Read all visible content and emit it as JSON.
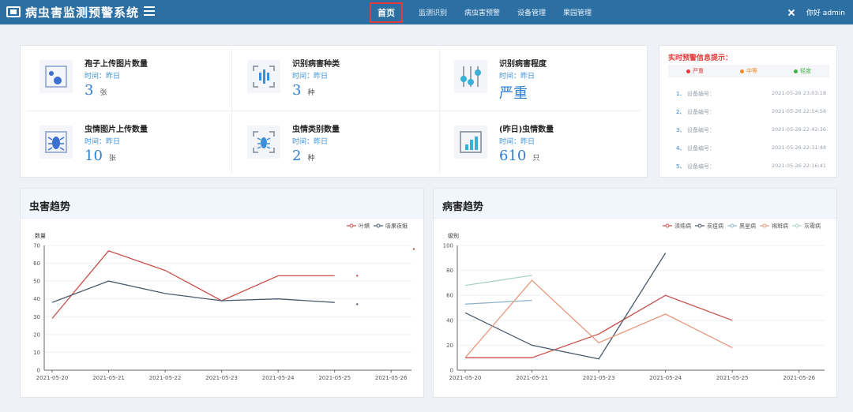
{
  "header": {
    "title": "病虫害监测预警系统",
    "nav": [
      "首页",
      "监测识别",
      "病虫害预警",
      "设备管理",
      "果园管理"
    ],
    "active_index": 0,
    "greeting": "你好 admin"
  },
  "stats": [
    {
      "label": "孢子上传图片数量",
      "time": "时间：昨日",
      "value": "3",
      "unit": "张",
      "icon": "spore-image-icon"
    },
    {
      "label": "识别病害种类",
      "time": "时间：昨日",
      "value": "3",
      "unit": "种",
      "icon": "disease-scan-icon"
    },
    {
      "label": "识别病害程度",
      "time": "时间：昨日",
      "value": "严重",
      "unit": "",
      "icon": "slider-level-icon"
    },
    {
      "label": "虫情图片上传数量",
      "time": "时间：昨日",
      "value": "10",
      "unit": "张",
      "icon": "insect-image-icon"
    },
    {
      "label": "虫情类别数量",
      "time": "时间：昨日",
      "value": "2",
      "unit": "种",
      "icon": "insect-scan-icon"
    },
    {
      "label": "(昨日)虫情数量",
      "time": "时间：昨日",
      "value": "610",
      "unit": "只",
      "icon": "bar-chart-icon"
    }
  ],
  "warning": {
    "title": "实时预警信息提示：",
    "levels": [
      {
        "label": "严重",
        "color": "#e53a3a"
      },
      {
        "label": "中等",
        "color": "#f08a24"
      },
      {
        "label": "轻度",
        "color": "#3cb043"
      }
    ],
    "items": [
      {
        "no": "1、",
        "device": "设备编号：",
        "time": "2021-05-26 23:03:18"
      },
      {
        "no": "2、",
        "device": "设备编号：",
        "time": "2021-05-26 22:54:58"
      },
      {
        "no": "3、",
        "device": "设备编号：",
        "time": "2021-05-26 22:42:36"
      },
      {
        "no": "4、",
        "device": "设备编号：",
        "time": "2021-05-26 22:31:48"
      },
      {
        "no": "5、",
        "device": "设备编号：",
        "time": "2021-05-26 22:16:41"
      }
    ]
  },
  "panels": {
    "pest_title": "虫害趋势",
    "disease_title": "病害趋势"
  },
  "chart_data": [
    {
      "type": "line",
      "title": "虫害趋势",
      "ylabel": "数量",
      "xlabel": "",
      "x": [
        "2021-05-20",
        "2021-05-21",
        "2021-05-22",
        "2021-05-23",
        "2021-05-24",
        "2021-05-25",
        "2021-05-26"
      ],
      "ylim": [
        0,
        70
      ],
      "yticks": [
        0,
        10,
        20,
        30,
        40,
        50,
        60,
        70
      ],
      "legend": "top-right",
      "series": [
        {
          "name": "叶螨",
          "color": "#c9504a",
          "values": [
            29,
            67,
            56,
            39,
            53,
            53,
            null
          ],
          "extra_points": [
            [
              5.4,
              53
            ],
            [
              6.4,
              68
            ]
          ]
        },
        {
          "name": "吸果夜蛾",
          "color": "#4b5a6b",
          "values": [
            38,
            50,
            43,
            39,
            40,
            38,
            null
          ],
          "extra_points": [
            [
              5.4,
              37
            ]
          ]
        }
      ]
    },
    {
      "type": "line",
      "title": "病害趋势",
      "ylabel": "级别",
      "xlabel": "",
      "x": [
        "2021-05-20",
        "2021-05-21",
        "2021-05-23",
        "2021-05-24",
        "2021-05-25",
        "2021-05-26"
      ],
      "ylim": [
        0,
        100
      ],
      "yticks": [
        0,
        20,
        40,
        60,
        80,
        100
      ],
      "legend": "top-right",
      "series": [
        {
          "name": "溃疡病",
          "color": "#c9504a",
          "values": [
            10,
            10,
            29,
            60,
            40,
            null
          ]
        },
        {
          "name": "炭疽病",
          "color": "#4b5a6b",
          "values": [
            46,
            20,
            9,
            94,
            null,
            null
          ]
        },
        {
          "name": "黑星病",
          "color": "#8fb4c9",
          "values": [
            53,
            56,
            null,
            null,
            null,
            null
          ]
        },
        {
          "name": "褐斑病",
          "color": "#e8977a",
          "values": [
            10,
            72,
            22,
            45,
            18,
            null
          ]
        },
        {
          "name": "灰霉病",
          "color": "#a9d4c4",
          "values": [
            68,
            76,
            null,
            null,
            null,
            null
          ]
        }
      ]
    }
  ]
}
